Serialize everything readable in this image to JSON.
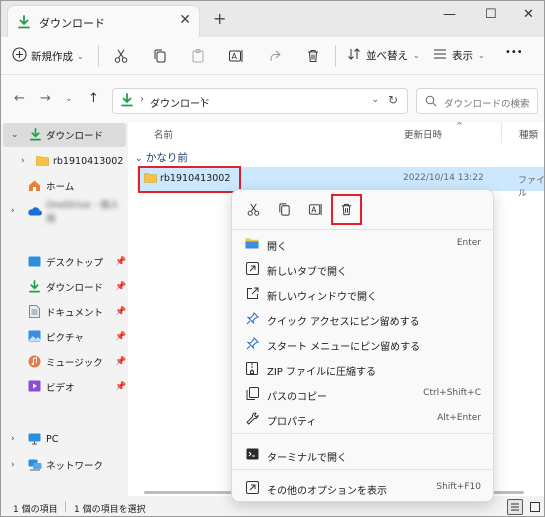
{
  "tab": {
    "title": "ダウンロード",
    "close": "✕",
    "new_tab": "+"
  },
  "window_controls": {
    "minimize": "—",
    "maximize": "☐",
    "close": "✕"
  },
  "toolbar": {
    "new_label": "新規作成",
    "sort_label": "並べ替え",
    "view_label": "表示",
    "more": "•••"
  },
  "address": {
    "location": "ダウンロード",
    "search_placeholder": "ダウンロードの検索"
  },
  "sidebar": {
    "items": [
      {
        "label": "ダウンロード"
      },
      {
        "label": "rb1910413002"
      },
      {
        "label": "ホーム"
      },
      {
        "label": "OneDrive - 個人用"
      },
      {
        "label": "デスクトップ"
      },
      {
        "label": "ダウンロード"
      },
      {
        "label": "ドキュメント"
      },
      {
        "label": "ピクチャ"
      },
      {
        "label": "ミュージック"
      },
      {
        "label": "ビデオ"
      },
      {
        "label": "PC"
      },
      {
        "label": "ネットワーク"
      }
    ]
  },
  "list": {
    "columns": {
      "name": "名前",
      "date": "更新日時",
      "type": "種類"
    },
    "group": "かなり前",
    "file": {
      "name": "rb1910413002",
      "date": "2022/10/14 13:22",
      "type": "ファイル"
    }
  },
  "context_menu": {
    "items": [
      {
        "label": "開く",
        "key": "Enter"
      },
      {
        "label": "新しいタブで開く",
        "key": ""
      },
      {
        "label": "新しいウィンドウで開く",
        "key": ""
      },
      {
        "label": "クイック アクセスにピン留めする",
        "key": ""
      },
      {
        "label": "スタート メニューにピン留めする",
        "key": ""
      },
      {
        "label": "ZIP ファイルに圧縮する",
        "key": ""
      },
      {
        "label": "パスのコピー",
        "key": "Ctrl+Shift+C"
      },
      {
        "label": "プロパティ",
        "key": "Alt+Enter"
      },
      {
        "label": "ターミナルで開く",
        "key": ""
      },
      {
        "label": "その他のオプションを表示",
        "key": "Shift+F10"
      }
    ]
  },
  "status": {
    "count": "1 個の項目",
    "selected": "1 個の項目を選択"
  },
  "colors": {
    "accent": "#0067c0",
    "selection": "#cce8ff",
    "highlight_box": "#e0202a",
    "download_green": "#1f9e4a",
    "folder_yellow": "#f6c343"
  }
}
